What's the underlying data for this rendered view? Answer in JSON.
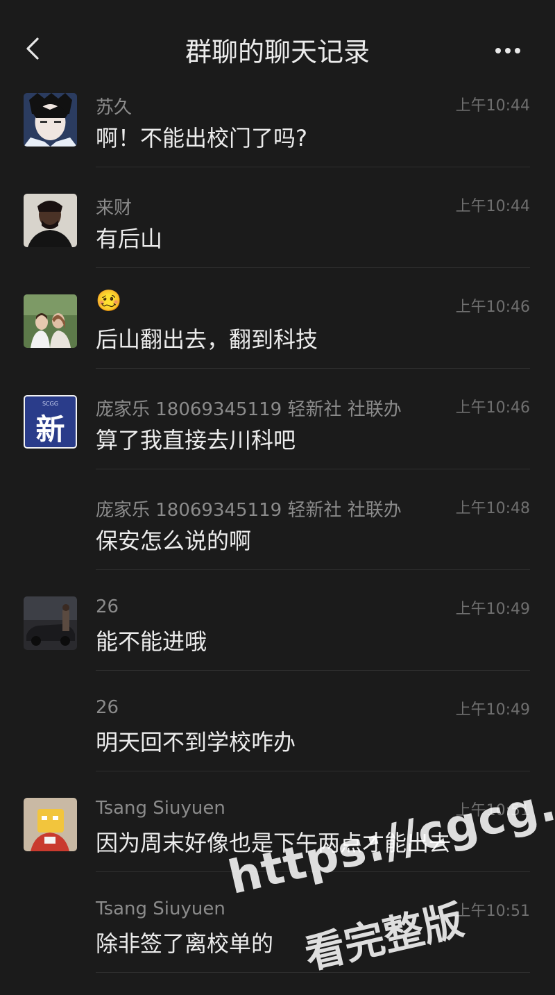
{
  "nav": {
    "title": "群聊的聊天记录"
  },
  "messages": [
    {
      "sender": "苏久",
      "time": "上午10:44",
      "text": "啊！不能出校门了吗?",
      "avatar": "anime-portrait"
    },
    {
      "sender": "来财",
      "time": "上午10:44",
      "text": "有后山",
      "avatar": "man-photo"
    },
    {
      "sender": "",
      "time": "上午10:46",
      "text": "后山翻出去，翻到科技",
      "avatar": "couple-photo",
      "emoji": "🥴"
    },
    {
      "sender": "庞家乐 18069345119 轻新社 社联办",
      "time": "上午10:46",
      "text": "算了我直接去川科吧",
      "avatar": "xin-logo"
    },
    {
      "sender": "庞家乐 18069345119 轻新社 社联办",
      "time": "上午10:48",
      "text": "保安怎么说的啊",
      "avatar": ""
    },
    {
      "sender": "26",
      "time": "上午10:49",
      "text": "能不能进哦",
      "avatar": "car-photo"
    },
    {
      "sender": "26",
      "time": "上午10:49",
      "text": "明天回不到学校咋办",
      "avatar": ""
    },
    {
      "sender": "Tsang Siuyuen",
      "time": "上午10:51",
      "text": "因为周末好像也是下午两点才能出去",
      "avatar": "cartoon-photo"
    },
    {
      "sender": "Tsang Siuyuen",
      "time": "上午10:51",
      "text": "除非签了离校单的",
      "avatar": ""
    }
  ],
  "logo_text": {
    "xin": "新",
    "xin_small": "SCGG"
  },
  "watermark": {
    "url": "https://cgcg.app",
    "caption": "看完整版"
  },
  "colors": {
    "background": "#1b1b1b",
    "text": "#ececec",
    "meta": "#8b8b8b"
  }
}
